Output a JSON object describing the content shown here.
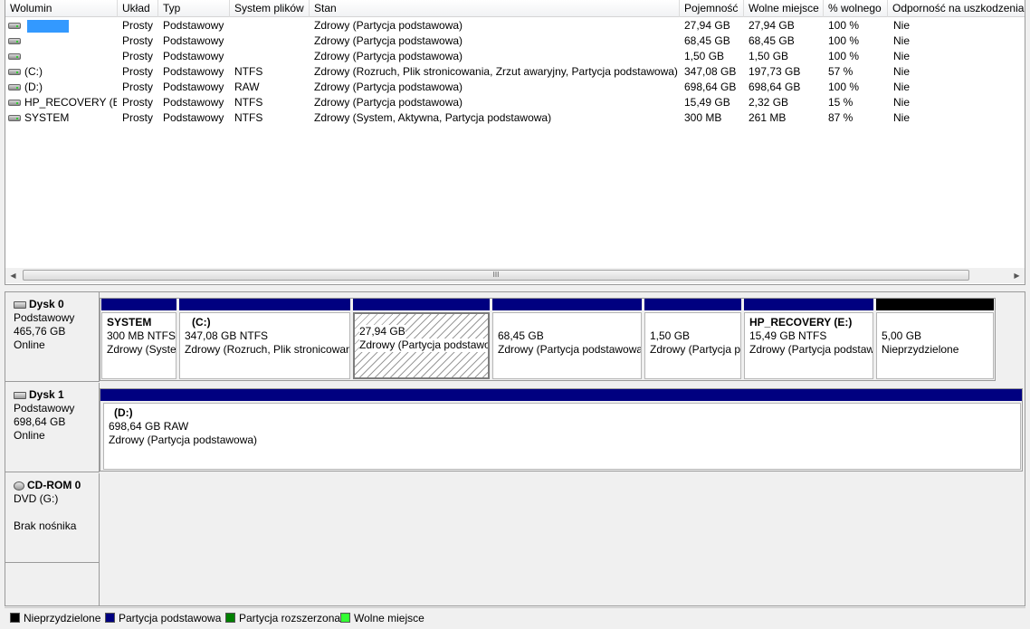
{
  "volume_list": {
    "columns": [
      "Wolumin",
      "Układ",
      "Typ",
      "System plików",
      "Stan",
      "Pojemność",
      "Wolne miejsce",
      "% wolnego",
      "Odporność na uszkodzenia"
    ],
    "rows": [
      {
        "name": "",
        "layout": "Prosty",
        "type": "Podstawowy",
        "fs": "",
        "status": "Zdrowy (Partycja podstawowa)",
        "capacity": "27,94 GB",
        "free": "27,94 GB",
        "pct": "100 %",
        "fault": "Nie"
      },
      {
        "name": "",
        "layout": "Prosty",
        "type": "Podstawowy",
        "fs": "",
        "status": "Zdrowy (Partycja podstawowa)",
        "capacity": "68,45 GB",
        "free": "68,45 GB",
        "pct": "100 %",
        "fault": "Nie"
      },
      {
        "name": "",
        "layout": "Prosty",
        "type": "Podstawowy",
        "fs": "",
        "status": "Zdrowy (Partycja podstawowa)",
        "capacity": "1,50 GB",
        "free": "1,50 GB",
        "pct": "100 %",
        "fault": "Nie"
      },
      {
        "name": "(C:)",
        "layout": "Prosty",
        "type": "Podstawowy",
        "fs": "NTFS",
        "status": "Zdrowy (Rozruch, Plik stronicowania, Zrzut awaryjny, Partycja podstawowa)",
        "capacity": "347,08 GB",
        "free": "197,73 GB",
        "pct": "57 %",
        "fault": "Nie"
      },
      {
        "name": "(D:)",
        "layout": "Prosty",
        "type": "Podstawowy",
        "fs": "RAW",
        "status": "Zdrowy (Partycja podstawowa)",
        "capacity": "698,64 GB",
        "free": "698,64 GB",
        "pct": "100 %",
        "fault": "Nie"
      },
      {
        "name": "HP_RECOVERY (E:)",
        "layout": "Prosty",
        "type": "Podstawowy",
        "fs": "NTFS",
        "status": "Zdrowy (Partycja podstawowa)",
        "capacity": "15,49 GB",
        "free": "2,32 GB",
        "pct": "15 %",
        "fault": "Nie"
      },
      {
        "name": "SYSTEM",
        "layout": "Prosty",
        "type": "Podstawowy",
        "fs": "NTFS",
        "status": "Zdrowy (System, Aktywna, Partycja podstawowa)",
        "capacity": "300 MB",
        "free": "261 MB",
        "pct": "87 %",
        "fault": "Nie"
      }
    ],
    "scroll_grip": "III"
  },
  "disks": [
    {
      "title": "Dysk 0",
      "kind": "Podstawowy",
      "size": "465,76 GB",
      "state": "Online",
      "partitions": [
        {
          "name": "SYSTEM",
          "line1": "300 MB NTFS",
          "line2": "Zdrowy (System, Aktywna, Partycja podstawowa)",
          "bar": "primary"
        },
        {
          "name": "(C:)",
          "line1": "347,08 GB NTFS",
          "line2": "Zdrowy (Rozruch, Plik stronicowania, Zrzut awaryjny, Partycja podstawowa)",
          "bar": "primary"
        },
        {
          "name": "",
          "line1": "27,94 GB",
          "line2": "Zdrowy (Partycja podstawowa)",
          "bar": "primary",
          "selected": true
        },
        {
          "name": "",
          "line1": "68,45 GB",
          "line2": "Zdrowy (Partycja podstawowa)",
          "bar": "primary"
        },
        {
          "name": "",
          "line1": "1,50 GB",
          "line2": "Zdrowy (Partycja podstawowa)",
          "bar": "primary"
        },
        {
          "name": "HP_RECOVERY  (E:)",
          "line1": "15,49 GB NTFS",
          "line2": "Zdrowy (Partycja podstawowa)",
          "bar": "primary"
        },
        {
          "name": "",
          "line1": "5,00 GB",
          "line2": "Nieprzydzielone",
          "bar": "unallocated"
        }
      ]
    },
    {
      "title": "Dysk 1",
      "kind": "Podstawowy",
      "size": "698,64 GB",
      "state": "Online",
      "partitions": [
        {
          "name": "(D:)",
          "line1": "698,64 GB RAW",
          "line2": "Zdrowy (Partycja podstawowa)",
          "bar": "primary"
        }
      ]
    }
  ],
  "cdrom": {
    "title": "CD-ROM 0",
    "drive": "DVD (G:)",
    "media": "Brak nośnika"
  },
  "legend": [
    {
      "label": "Nieprzydzielone",
      "color": "#000000"
    },
    {
      "label": "Partycja podstawowa",
      "color": "#000080"
    },
    {
      "label": "Partycja rozszerzona",
      "color": "#008000"
    },
    {
      "label": "Wolne miejsce",
      "color": "#33ff33"
    }
  ]
}
